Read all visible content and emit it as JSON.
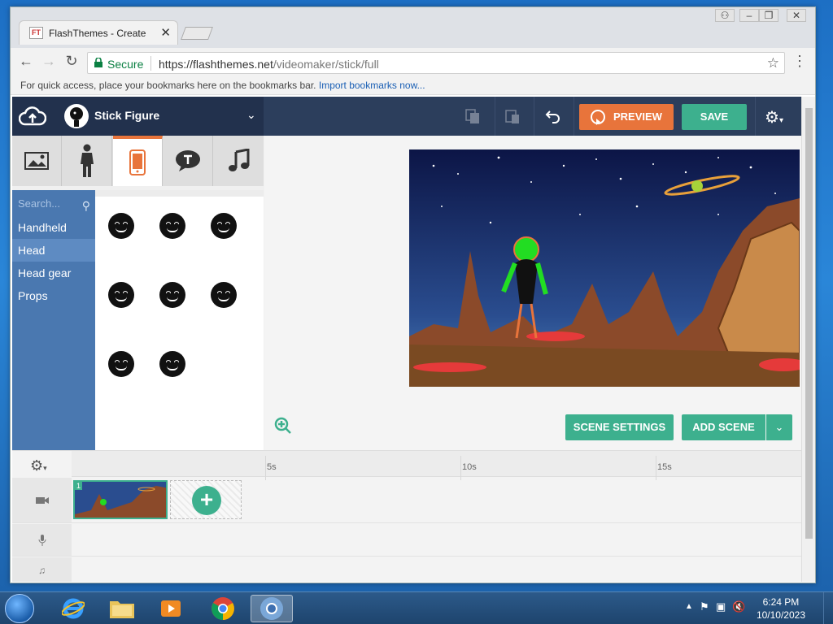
{
  "browser": {
    "tab_title": "FlashThemes - Create",
    "tab_favicon_text": "FT",
    "secure_label": "Secure",
    "url_host": "https://flashthemes.net",
    "url_path": "/videomaker/stick/full",
    "bookmarks_hint": "For quick access, place your bookmarks here on the bookmarks bar.",
    "import_bookmarks": "Import bookmarks now..."
  },
  "app": {
    "character_name": "Stick Figure",
    "preview_label": "PREVIEW",
    "save_label": "SAVE",
    "category_tabs": [
      "image-icon",
      "character-icon",
      "phone-icon",
      "speech-bubble-icon",
      "music-note-icon"
    ],
    "search_placeholder": "Search...",
    "sidebar_items": [
      "Handheld",
      "Head",
      "Head gear",
      "Props"
    ],
    "active_sidebar_item": "Head",
    "head_count": 8,
    "scene_settings_label": "SCENE SETTINGS",
    "add_scene_label": "ADD SCENE",
    "colors": {
      "accent_orange": "#e8743b",
      "accent_green": "#3db08e",
      "topbar": "#2c3e5c",
      "sidebar": "#4a78b0"
    }
  },
  "timeline": {
    "ticks": [
      "5s",
      "10s",
      "15s"
    ],
    "scene_number": "1",
    "rows": [
      "camera-icon",
      "microphone-icon",
      "music-note-icon"
    ]
  },
  "taskbar": {
    "apps": [
      "file-explorer-icon",
      "internet-explorer-icon",
      "folder-icon",
      "media-player-icon",
      "chrome-icon",
      "chrome-active-icon"
    ],
    "time": "6:24 PM",
    "date": "10/10/2023"
  }
}
